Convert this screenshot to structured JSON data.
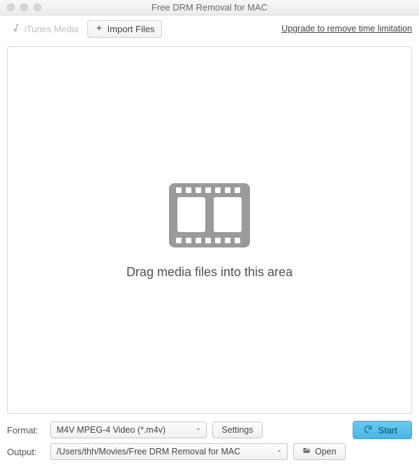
{
  "window": {
    "title": "Free DRM Removal for MAC"
  },
  "toolbar": {
    "itunes_label": "iTunes Media",
    "import_label": "Import Files",
    "upgrade_label": "Upgrade to remove time limitation"
  },
  "dropzone": {
    "hint": "Drag media files into this area"
  },
  "bottom": {
    "format_label": "Format:",
    "format_value": "M4V MPEG-4 Video (*.m4v)",
    "settings_label": "Settings",
    "output_label": "Output:",
    "output_value": "/Users/thh/Movies/Free DRM Removal for MAC",
    "open_label": "Open",
    "start_label": "Start"
  }
}
